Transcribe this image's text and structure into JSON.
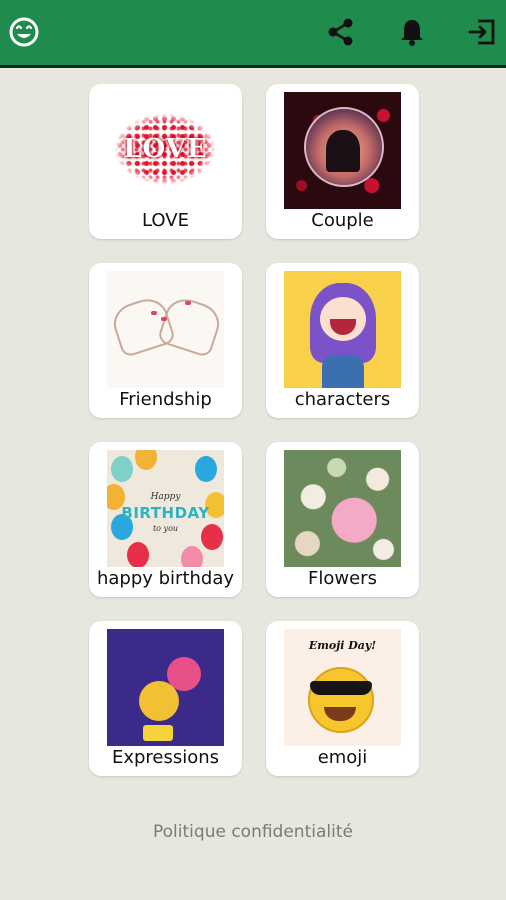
{
  "header": {
    "icons": [
      "emoji-logo-icon",
      "share-icon",
      "bell-icon",
      "exit-icon"
    ],
    "background": "#1f8b4c"
  },
  "categories": [
    {
      "label": "LOVE",
      "thumb": "love"
    },
    {
      "label": "Couple",
      "thumb": "couple"
    },
    {
      "label": "Friendship",
      "thumb": "friendship"
    },
    {
      "label": "characters",
      "thumb": "characters"
    },
    {
      "label": "happy birthday",
      "thumb": "birthday"
    },
    {
      "label": "Flowers",
      "thumb": "flowers"
    },
    {
      "label": "Expressions",
      "thumb": "expressions"
    },
    {
      "label": "emoji",
      "thumb": "emoji"
    }
  ],
  "thumb_text": {
    "love_word": "LOVE",
    "birthday_line1": "Happy",
    "birthday_line2": "BIRTHDAY",
    "birthday_line3": "to you",
    "emoji_title": "Emoji Day!"
  },
  "footer": {
    "privacy_label": "Politique confidentialité"
  }
}
